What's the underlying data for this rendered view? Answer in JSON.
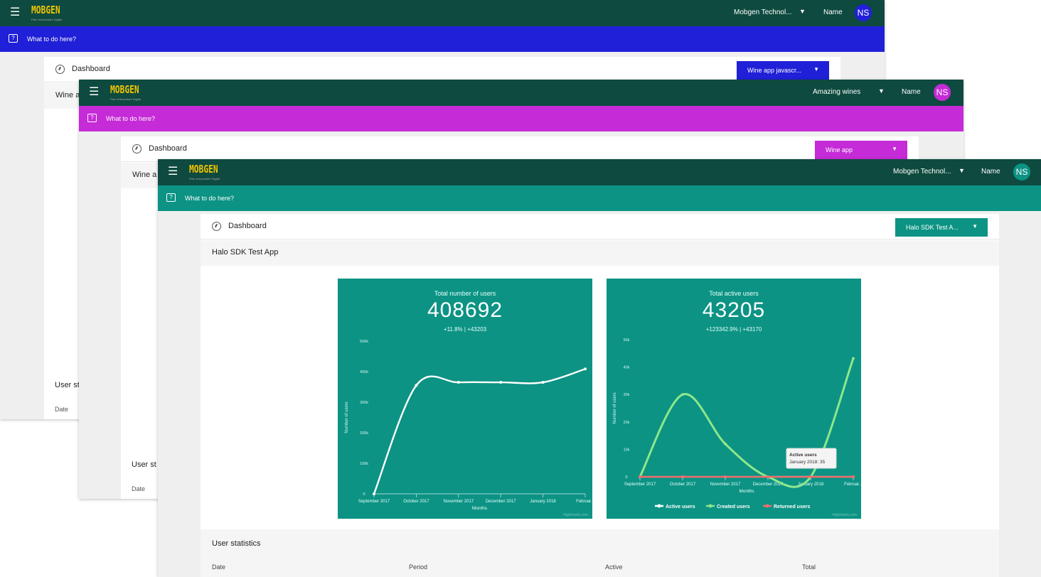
{
  "windows": [
    {
      "logo": "MOBGEN",
      "logo_sub": "Part of Accenture Digital",
      "org": "Mobgen Technol...",
      "user_name": "Name",
      "avatar": "NS",
      "help": "What to do here?",
      "dashboard": "Dashboard",
      "app_select": "Wine app javascr...",
      "app_title": "Wine a",
      "user_stats": "User st",
      "date": "Date",
      "colors": {
        "topbar": "#0e4a3f",
        "accent": "#2020d8"
      }
    },
    {
      "logo": "MOBGEN",
      "logo_sub": "Part of Accenture Digital",
      "org": "Amazing wines",
      "user_name": "Name",
      "avatar": "NS",
      "help": "What to do here?",
      "dashboard": "Dashboard",
      "app_select": "Wine app",
      "app_title": "Wine a",
      "user_stats": "User st",
      "date": "Date",
      "colors": {
        "topbar": "#0e4a3f",
        "accent": "#c52bd6"
      }
    },
    {
      "logo": "MOBGEN",
      "logo_sub": "Part of Accenture Digital",
      "org": "Mobgen Technol...",
      "user_name": "Name",
      "avatar": "NS",
      "help": "What to do here?",
      "dashboard": "Dashboard",
      "app_select": "Halo SDK Test A...",
      "app_title": "Halo SDK Test App",
      "user_stats": "User statistics",
      "table_headers": [
        "Date",
        "Period",
        "Active",
        "Total"
      ],
      "colors": {
        "topbar": "#0e4a3f",
        "accent": "#0c9384"
      }
    }
  ],
  "chart_data": [
    {
      "type": "line",
      "title": "Total number of users",
      "big_number": "408692",
      "subtitle": "+11.8% | +43203",
      "xlabel": "Months",
      "ylabel": "Number of users",
      "categories": [
        "September 2017",
        "October 2017",
        "November 2017",
        "December 2017",
        "January 2018",
        "Februar..."
      ],
      "y_ticks": [
        "0",
        "100k",
        "200k",
        "300k",
        "400k",
        "500k"
      ],
      "ylim": [
        0,
        500000
      ],
      "series": [
        {
          "values": [
            0,
            355000,
            365000,
            365000,
            365000,
            408692
          ],
          "color": "#ffffff"
        }
      ],
      "extra_point": {
        "x_index": 5.0,
        "value": 408692
      },
      "credit": "Highcharts.com"
    },
    {
      "type": "line",
      "title": "Total active users",
      "big_number": "43205",
      "subtitle": "+123342.9% | +43170",
      "xlabel": "Months",
      "ylabel": "Number of users",
      "categories": [
        "September 2017",
        "October 2017",
        "November 2017",
        "December 2017",
        "January 2018",
        "Februar..."
      ],
      "y_ticks": [
        "0",
        "10k",
        "20k",
        "30k",
        "40k",
        "50k"
      ],
      "ylim": [
        0,
        50000
      ],
      "series": [
        {
          "name": "Active users",
          "values": [
            0,
            0,
            0,
            0,
            35,
            0
          ],
          "color": "#ffffff"
        },
        {
          "name": "Created users",
          "values": [
            0,
            30000,
            12000,
            0,
            0,
            43170
          ],
          "color": "#8ee78a"
        },
        {
          "name": "Returned users",
          "values": [
            0,
            0,
            0,
            0,
            0,
            0
          ],
          "color": "#f26d6d"
        }
      ],
      "tooltip": {
        "title": "Active users",
        "text": "January 2018: 35"
      },
      "legend_position": "bottom",
      "credit": "Highcharts.com"
    }
  ]
}
